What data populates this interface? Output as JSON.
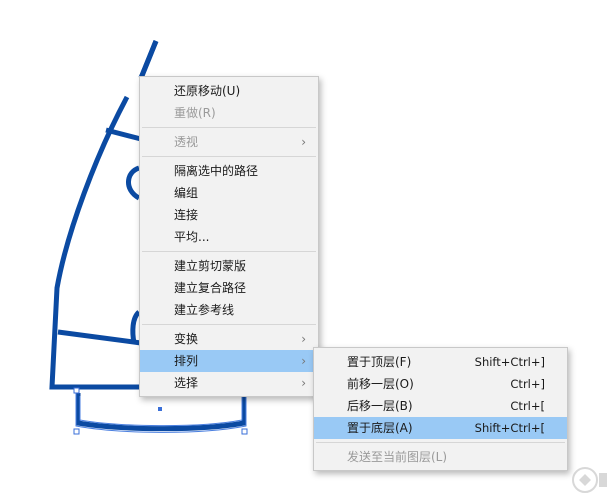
{
  "context_menu": {
    "items": [
      {
        "label": "还原移动(U)"
      },
      {
        "label": "重做(R)"
      },
      {
        "label": "透视"
      },
      {
        "label": "隔离选中的路径"
      },
      {
        "label": "编组"
      },
      {
        "label": "连接"
      },
      {
        "label": "平均..."
      },
      {
        "label": "建立剪切蒙版"
      },
      {
        "label": "建立复合路径"
      },
      {
        "label": "建立参考线"
      },
      {
        "label": "变换"
      },
      {
        "label": "排列"
      },
      {
        "label": "选择"
      }
    ],
    "arrow_glyph": "›"
  },
  "arrange_submenu": {
    "items": [
      {
        "label": "置于顶层(F)",
        "shortcut": "Shift+Ctrl+]"
      },
      {
        "label": "前移一层(O)",
        "shortcut": "Ctrl+]"
      },
      {
        "label": "后移一层(B)",
        "shortcut": "Ctrl+["
      },
      {
        "label": "置于底层(A)",
        "shortcut": "Shift+Ctrl+["
      },
      {
        "label": "发送至当前图层(L)",
        "shortcut": ""
      }
    ]
  },
  "colors": {
    "menu_bg": "#f2f2f2",
    "highlight": "#99c9f5",
    "disabled_text": "#9a9a9a",
    "artwork_stroke": "#0b4aa2"
  },
  "icons": {
    "submenu_arrow": "chevron-right-icon",
    "watermark": "watermark-logo-icon"
  }
}
